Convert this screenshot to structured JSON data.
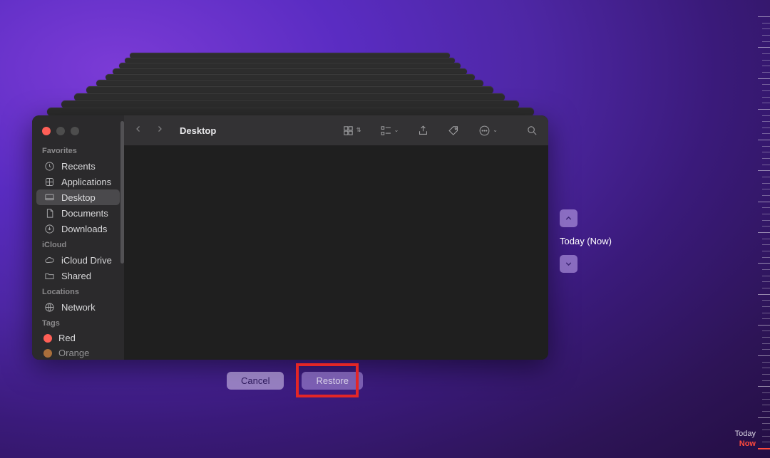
{
  "finder": {
    "title": "Desktop",
    "sidebar": {
      "sections": [
        {
          "heading": "Favorites",
          "items": [
            {
              "icon": "clock",
              "label": "Recents",
              "selected": false
            },
            {
              "icon": "app",
              "label": "Applications",
              "selected": false
            },
            {
              "icon": "desktop",
              "label": "Desktop",
              "selected": true
            },
            {
              "icon": "doc",
              "label": "Documents",
              "selected": false
            },
            {
              "icon": "download",
              "label": "Downloads",
              "selected": false
            }
          ]
        },
        {
          "heading": "iCloud",
          "items": [
            {
              "icon": "cloud",
              "label": "iCloud Drive",
              "selected": false
            },
            {
              "icon": "folder",
              "label": "Shared",
              "selected": false
            }
          ]
        },
        {
          "heading": "Locations",
          "items": [
            {
              "icon": "globe",
              "label": "Network",
              "selected": false
            }
          ]
        },
        {
          "heading": "Tags",
          "items": [
            {
              "icon": "tag",
              "label": "Red",
              "color": "#ff5f56",
              "selected": false
            },
            {
              "icon": "tag",
              "label": "Orange",
              "color": "#ff9f46",
              "selected": false
            }
          ]
        }
      ]
    }
  },
  "timeline": {
    "label": "Today (Now)",
    "today_label": "Today",
    "now_label": "Now"
  },
  "buttons": {
    "cancel": "Cancel",
    "restore": "Restore"
  }
}
